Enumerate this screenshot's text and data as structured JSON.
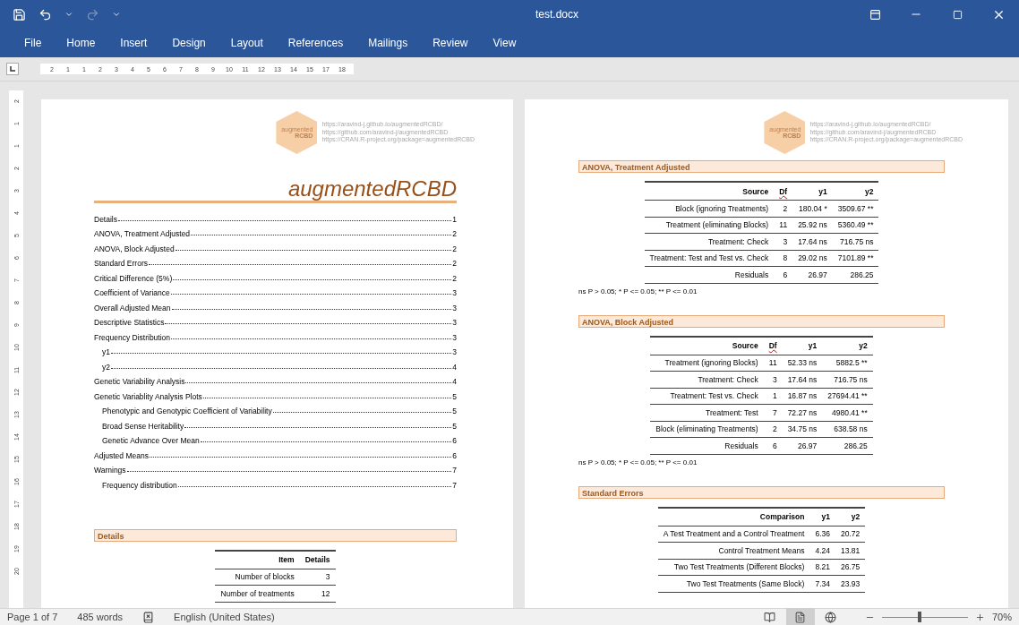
{
  "window": {
    "title": "test.docx"
  },
  "quick_access": [
    {
      "kind": "save",
      "disabled": false
    },
    {
      "kind": "undo",
      "disabled": false
    },
    {
      "kind": "undo-menu",
      "disabled": false
    },
    {
      "kind": "redo",
      "disabled": true
    },
    {
      "kind": "customize",
      "disabled": false
    }
  ],
  "menu": [
    {
      "label": "File",
      "selected": false
    },
    {
      "label": "Home",
      "selected": false
    },
    {
      "label": "Insert",
      "selected": false
    },
    {
      "label": "Design",
      "selected": false
    },
    {
      "label": "Layout",
      "selected": false
    },
    {
      "label": "References",
      "selected": false
    },
    {
      "label": "Mailings",
      "selected": false
    },
    {
      "label": "Review",
      "selected": false
    },
    {
      "label": "View",
      "selected": false
    }
  ],
  "ruler": {
    "horizontal": [
      "2",
      "1",
      "1",
      "2",
      "3",
      "4",
      "5",
      "6",
      "7",
      "8",
      "9",
      "10",
      "11",
      "12",
      "13",
      "14",
      "15",
      "17",
      "18"
    ],
    "vertical": [
      "2",
      "1",
      "1",
      "2",
      "3",
      "4",
      "5",
      "6",
      "7",
      "8",
      "9",
      "10",
      "11",
      "12",
      "13",
      "14",
      "15",
      "16",
      "17",
      "18",
      "19",
      "20"
    ]
  },
  "pages": [
    {
      "header": {
        "logo_top": "augmented",
        "logo_bottom": "RCBD",
        "links": [
          "https://aravind-j.github.io/augmentedRCBD/",
          "https://github.com/aravind-j/augmentedRCBD",
          "https://CRAN.R-project.org/package=augmentedRCBD"
        ]
      },
      "title": "augmentedRCBD",
      "toc": [
        {
          "text": "Details",
          "page": "1"
        },
        {
          "text": "ANOVA, Treatment Adjusted",
          "page": "2"
        },
        {
          "text": "ANOVA, Block Adjusted",
          "page": "2"
        },
        {
          "text": "Standard Errors",
          "page": "2"
        },
        {
          "text": "Critical Difference (5%)",
          "page": "2"
        },
        {
          "text": "Coefficient of Variance",
          "page": "3"
        },
        {
          "text": "Overall Adjusted Mean",
          "page": "3"
        },
        {
          "text": "Descriptive Statistics",
          "page": "3"
        },
        {
          "text": "Frequency Distribution",
          "page": "3",
          "children": [
            {
              "text": "y1",
              "page": "3"
            },
            {
              "text": "y2",
              "page": "4"
            }
          ]
        },
        {
          "text": "Genetic Variability Analysis",
          "page": "4"
        },
        {
          "text": "Genetic Variablity Analysis Plots",
          "page": "5",
          "children": [
            {
              "text": "Phenotypic and Genotypic Coefficient of Variability",
              "page": "5"
            },
            {
              "text": "Broad Sense Heritability",
              "page": "5"
            },
            {
              "text": "Genetic Advance Over Mean",
              "page": "6"
            }
          ]
        },
        {
          "text": "Adjusted Means",
          "page": "6"
        },
        {
          "text": "Warnings",
          "page": "7",
          "children": [
            {
              "text": "Frequency distribution",
              "page": "7"
            }
          ]
        }
      ],
      "sections": [
        {
          "heading": "Details",
          "table": {
            "columns": [
              {
                "label": "Item",
                "misspelled": false
              },
              {
                "label": "Details",
                "misspelled": false
              }
            ],
            "rows": [
              [
                "Number of blocks",
                "3"
              ],
              [
                "Number of treatments",
                "12"
              ]
            ]
          }
        }
      ]
    },
    {
      "header": {
        "logo_top": "augmented",
        "logo_bottom": "RCBD",
        "links": [
          "https://aravind-j.github.io/augmentedRCBD/",
          "https://github.com/aravind-j/augmentedRCBD",
          "https://CRAN.R-project.org/package=augmentedRCBD"
        ]
      },
      "sections": [
        {
          "heading": "ANOVA, Treatment Adjusted",
          "table": {
            "columns": [
              {
                "label": "Source",
                "misspelled": false
              },
              {
                "label": "Df",
                "misspelled": true
              },
              {
                "label": "y1",
                "misspelled": false
              },
              {
                "label": "y2",
                "misspelled": false
              }
            ],
            "rows": [
              [
                "Block (ignoring Treatments)",
                "2",
                "180.04 *",
                "3509.67 **"
              ],
              [
                "Treatment (eliminating Blocks)",
                "11",
                "25.92 ns",
                "5360.49 **"
              ],
              [
                "Treatment: Check",
                "3",
                "17.64 ns",
                "716.75 ns"
              ],
              [
                "Treatment: Test and Test vs. Check",
                "8",
                "29.02 ns",
                "7101.89 **"
              ],
              [
                "Residuals",
                "6",
                "26.97",
                "286.25"
              ]
            ]
          },
          "note": "ns P > 0.05; * P <= 0.05; ** P <= 0.01"
        },
        {
          "heading": "ANOVA, Block Adjusted",
          "table": {
            "columns": [
              {
                "label": "Source",
                "misspelled": false
              },
              {
                "label": "Df",
                "misspelled": true
              },
              {
                "label": "y1",
                "misspelled": false
              },
              {
                "label": "y2",
                "misspelled": false
              }
            ],
            "rows": [
              [
                "Treatment (ignoring Blocks)",
                "11",
                "52.33 ns",
                "5882.5 **"
              ],
              [
                "Treatment: Check",
                "3",
                "17.64 ns",
                "716.75 ns"
              ],
              [
                "Treatment: Test vs. Check",
                "1",
                "16.87 ns",
                "27694.41 **"
              ],
              [
                "Treatment: Test",
                "7",
                "72.27 ns",
                "4980.41 **"
              ],
              [
                "Block (eliminating Treatments)",
                "2",
                "34.75 ns",
                "638.58 ns"
              ],
              [
                "Residuals",
                "6",
                "26.97",
                "286.25"
              ]
            ]
          },
          "note": "ns P > 0.05; * P <= 0.05; ** P <= 0.01"
        },
        {
          "heading": "Standard Errors",
          "table": {
            "columns": [
              {
                "label": "Comparison",
                "misspelled": false
              },
              {
                "label": "y1",
                "misspelled": false
              },
              {
                "label": "y2",
                "misspelled": false
              }
            ],
            "rows": [
              [
                "A Test Treatment and a Control Treatment",
                "6.36",
                "20.72"
              ],
              [
                "Control Treatment Means",
                "4.24",
                "13.81"
              ],
              [
                "Two Test Treatments (Different Blocks)",
                "8.21",
                "26.75"
              ],
              [
                "Two Test Treatments (Same Block)",
                "7.34",
                "23.93"
              ]
            ]
          }
        }
      ]
    }
  ],
  "status_bar": {
    "page": "Page 1 of 7",
    "words": "485 words",
    "language": "English (United States)",
    "views": [
      {
        "kind": "read",
        "selected": false
      },
      {
        "kind": "print",
        "selected": true
      },
      {
        "kind": "web",
        "selected": false
      }
    ],
    "zoom": {
      "level": 0.42,
      "reading": "70%"
    }
  }
}
